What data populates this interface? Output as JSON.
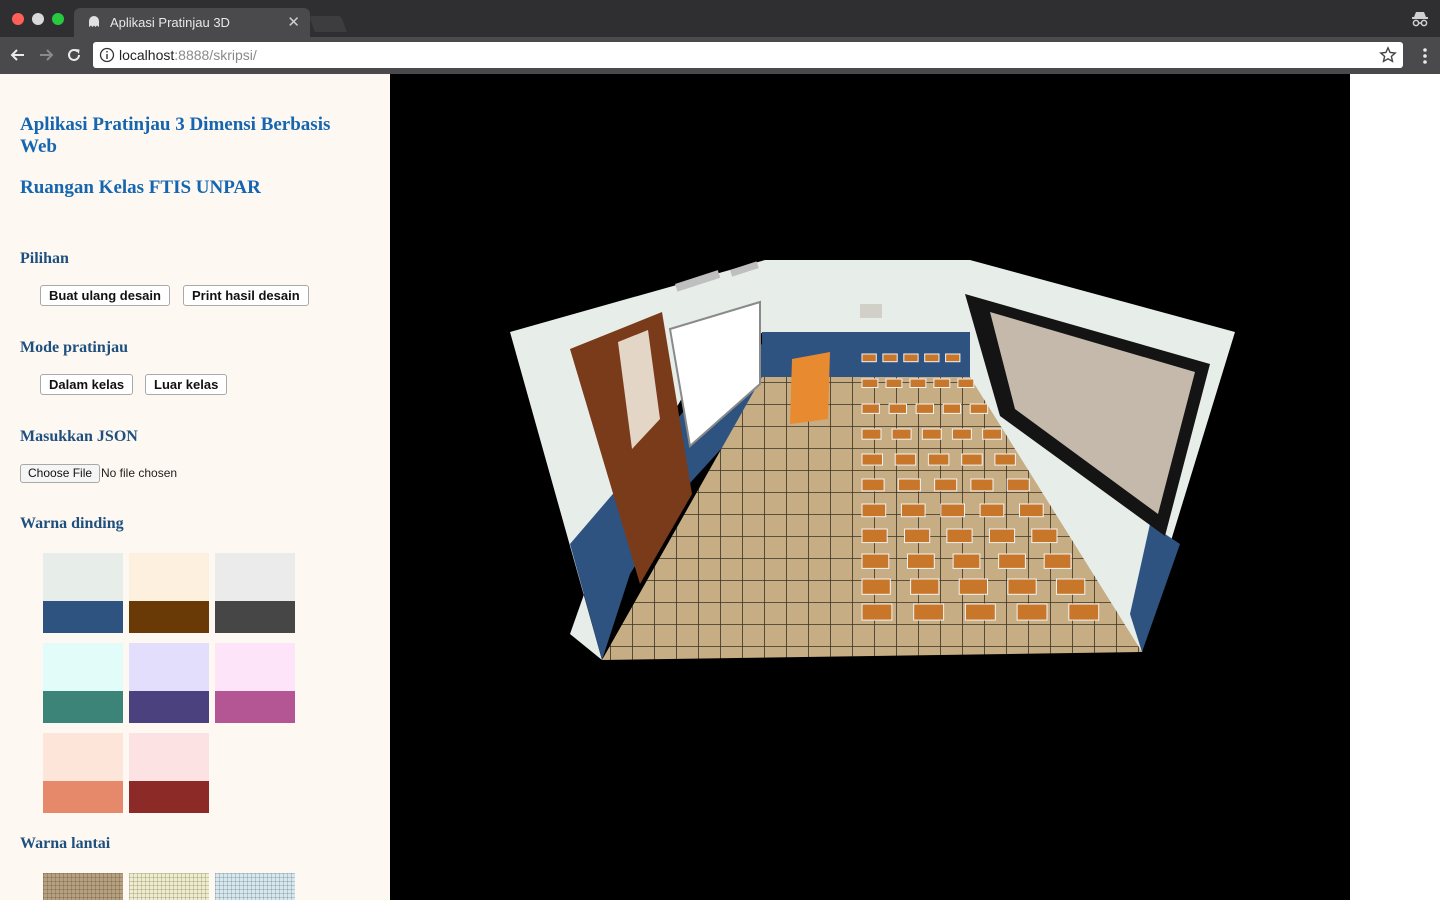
{
  "browser": {
    "tab_title": "Aplikasi Pratinjau 3D",
    "url_host": "localhost",
    "url_rest": ":8888/skripsi/"
  },
  "sidebar": {
    "title": "Aplikasi Pratinjau 3 Dimensi Berbasis Web",
    "subtitle": "Ruangan Kelas FTIS UNPAR",
    "options": {
      "heading": "Pilihan",
      "reset_label": "Buat ulang desain",
      "print_label": "Print hasil desain"
    },
    "preview_mode": {
      "heading": "Mode pratinjau",
      "inside_label": "Dalam kelas",
      "outside_label": "Luar kelas"
    },
    "json_input": {
      "heading": "Masukkan JSON",
      "button_label": "Choose File",
      "status": "No file chosen"
    },
    "wall_colors": {
      "heading": "Warna dinding",
      "swatches": [
        {
          "top": "#e7ede9",
          "bottom": "#2e5380"
        },
        {
          "top": "#fef0de",
          "bottom": "#6a3a06"
        },
        {
          "top": "#ebebeb",
          "bottom": "#464646"
        },
        {
          "top": "#e2fdf9",
          "bottom": "#3c8478"
        },
        {
          "top": "#e3defb",
          "bottom": "#4c417f"
        },
        {
          "top": "#fde4f8",
          "bottom": "#b45693"
        },
        {
          "top": "#fde5da",
          "bottom": "#e6896a"
        },
        {
          "top": "#fde2e4",
          "bottom": "#8c2a28"
        }
      ]
    },
    "floor_colors": {
      "heading": "Warna lantai",
      "swatches": [
        "#b7a07e",
        "#efeccc",
        "#d5e7ef"
      ]
    }
  },
  "icons": {
    "favicon": "ghost-icon",
    "incognito": "incognito-icon",
    "back": "arrow-left-icon",
    "forward": "arrow-right-icon",
    "reload": "reload-icon",
    "info": "info-icon",
    "bookmark": "star-icon",
    "menu": "kebab-menu-icon"
  }
}
